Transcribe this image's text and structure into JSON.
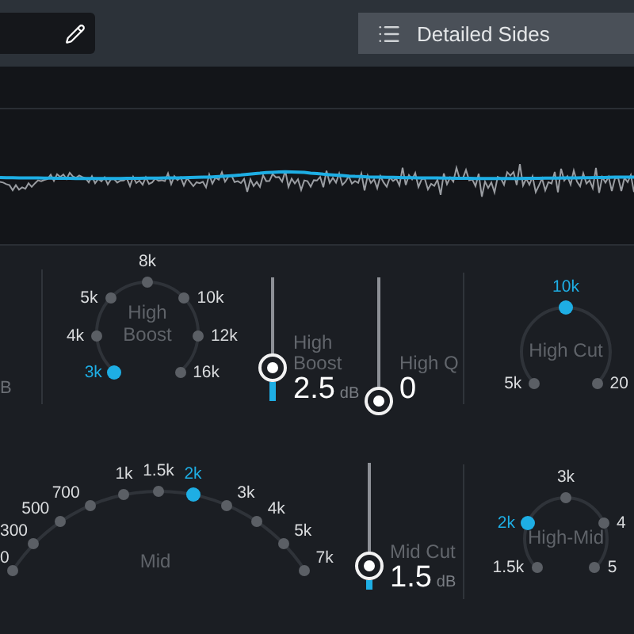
{
  "preset": {
    "label": "Detailed Sides"
  },
  "cut_label": "B",
  "rows": [
    {
      "items": [
        {
          "kind": "dial",
          "title": "High Boost",
          "options": [
            {
              "label": "3k",
              "selected": true
            },
            {
              "label": "4k",
              "selected": false
            },
            {
              "label": "5k",
              "selected": false
            },
            {
              "label": "8k",
              "selected": false
            },
            {
              "label": "10k",
              "selected": false
            },
            {
              "label": "12k",
              "selected": false
            },
            {
              "label": "16k",
              "selected": false
            }
          ]
        },
        {
          "kind": "slider",
          "label": "High Boost",
          "value": "2.5",
          "unit": "dB",
          "level": 0.27
        },
        {
          "kind": "slider",
          "label": "High Q",
          "value": "0",
          "level": 0
        },
        {
          "kind": "dial",
          "title": "High Cut",
          "options": [
            {
              "label": "5k",
              "selected": false
            },
            {
              "label": "10k",
              "selected": true
            },
            {
              "label": "20",
              "selected": false
            }
          ]
        }
      ]
    },
    {
      "items": [
        {
          "kind": "dial",
          "title": "Mid",
          "options": [
            {
              "label": "0",
              "selected": false
            },
            {
              "label": "300",
              "selected": false
            },
            {
              "label": "500",
              "selected": false
            },
            {
              "label": "700",
              "selected": false
            },
            {
              "label": "1k",
              "selected": false
            },
            {
              "label": "1.5k",
              "selected": false
            },
            {
              "label": "2k",
              "selected": true
            },
            {
              "label": "3k",
              "selected": false
            },
            {
              "label": "4k",
              "selected": false
            },
            {
              "label": "5k",
              "selected": false
            },
            {
              "label": "7k",
              "selected": false
            }
          ]
        },
        {
          "kind": "slider",
          "label": "Mid Cut",
          "value": "1.5",
          "unit": "dB",
          "level": 0.19
        },
        {
          "kind": "dial",
          "title": "High-Mid",
          "options": [
            {
              "label": "1.5k",
              "selected": false
            },
            {
              "label": "2k",
              "selected": true
            },
            {
              "label": "3k",
              "selected": false
            },
            {
              "label": "4",
              "selected": false
            },
            {
              "label": "5",
              "selected": false
            }
          ]
        }
      ]
    }
  ]
}
